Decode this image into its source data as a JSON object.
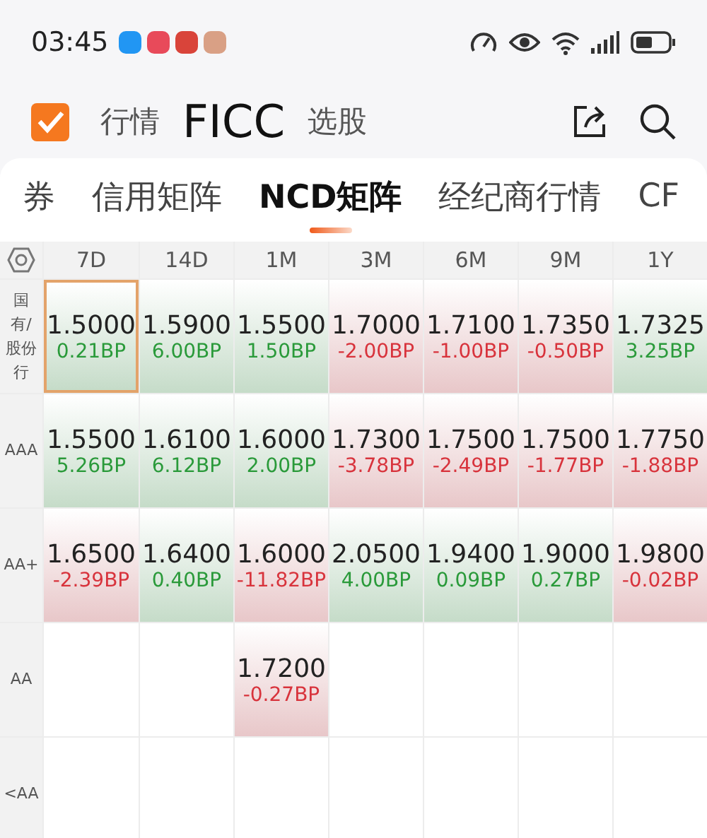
{
  "status_bar": {
    "time": "03:45"
  },
  "header": {
    "tabs": [
      {
        "label": "行情",
        "selected": false
      },
      {
        "label": "FICC",
        "selected": true
      },
      {
        "label": "选股",
        "selected": false
      }
    ]
  },
  "sub_tabs": [
    {
      "label": "券",
      "selected": false
    },
    {
      "label": "信用矩阵",
      "selected": false
    },
    {
      "label": "NCD矩阵",
      "selected": true
    },
    {
      "label": "经纪商行情",
      "selected": false
    },
    {
      "label": "CF",
      "selected": false
    }
  ],
  "table": {
    "columns": [
      "7D",
      "14D",
      "1M",
      "3M",
      "6M",
      "9M",
      "1Y"
    ],
    "rows": [
      {
        "label": [
          "国",
          "有/",
          "股份",
          "行"
        ],
        "cells": [
          {
            "kind": "quote",
            "value": "1.5000",
            "change": "0.21BP",
            "color": "#2a9a3a",
            "selected": true
          },
          {
            "kind": "quote",
            "value": "1.5900",
            "change": "6.00BP",
            "color": "#2a9a3a",
            "selected": false
          },
          {
            "kind": "quote",
            "value": "1.5500",
            "change": "1.50BP",
            "color": "#2a9a3a",
            "selected": false
          },
          {
            "kind": "quote",
            "value": "1.7000",
            "change": "-2.00BP",
            "color": "#d8333c",
            "selected": false
          },
          {
            "kind": "quote",
            "value": "1.7100",
            "change": "-1.00BP",
            "color": "#d8333c",
            "selected": false
          },
          {
            "kind": "quote",
            "value": "1.7350",
            "change": "-0.50BP",
            "color": "#d8333c",
            "selected": false
          },
          {
            "kind": "quote",
            "value": "1.7325",
            "change": "3.25BP",
            "color": "#2a9a3a",
            "selected": false
          }
        ]
      },
      {
        "label": [
          "AAA"
        ],
        "cells": [
          {
            "kind": "quote",
            "value": "1.5500",
            "change": "5.26BP",
            "color": "#2a9a3a",
            "selected": false
          },
          {
            "kind": "quote",
            "value": "1.6100",
            "change": "6.12BP",
            "color": "#2a9a3a",
            "selected": false
          },
          {
            "kind": "quote",
            "value": "1.6000",
            "change": "2.00BP",
            "color": "#2a9a3a",
            "selected": false
          },
          {
            "kind": "quote",
            "value": "1.7300",
            "change": "-3.78BP",
            "color": "#d8333c",
            "selected": false
          },
          {
            "kind": "quote",
            "value": "1.7500",
            "change": "-2.49BP",
            "color": "#d8333c",
            "selected": false
          },
          {
            "kind": "quote",
            "value": "1.7500",
            "change": "-1.77BP",
            "color": "#d8333c",
            "selected": false
          },
          {
            "kind": "quote",
            "value": "1.7750",
            "change": "-1.88BP",
            "color": "#d8333c",
            "selected": false
          }
        ]
      },
      {
        "label": [
          "AA+"
        ],
        "cells": [
          {
            "kind": "quote",
            "value": "1.6500",
            "change": "-2.39BP",
            "color": "#d8333c",
            "selected": false
          },
          {
            "kind": "quote",
            "value": "1.6400",
            "change": "0.40BP",
            "color": "#2a9a3a",
            "selected": false
          },
          {
            "kind": "quote",
            "value": "1.6000",
            "change": "-11.82BP",
            "color": "#d8333c",
            "selected": false
          },
          {
            "kind": "quote",
            "value": "2.0500",
            "change": "4.00BP",
            "color": "#2a9a3a",
            "selected": false
          },
          {
            "kind": "quote",
            "value": "1.9400",
            "change": "0.09BP",
            "color": "#2a9a3a",
            "selected": false
          },
          {
            "kind": "quote",
            "value": "1.9000",
            "change": "0.27BP",
            "color": "#2a9a3a",
            "selected": false
          },
          {
            "kind": "quote",
            "value": "1.9800",
            "change": "-0.02BP",
            "color": "#d8333c",
            "selected": false
          }
        ]
      },
      {
        "label": [
          "AA"
        ],
        "cells": [
          {
            "kind": "empty"
          },
          {
            "kind": "empty"
          },
          {
            "kind": "quote",
            "value": "1.7200",
            "change": "-0.27BP",
            "color": "#d8333c",
            "selected": false
          },
          {
            "kind": "empty"
          },
          {
            "kind": "empty"
          },
          {
            "kind": "empty"
          },
          {
            "kind": "empty"
          }
        ]
      },
      {
        "label": [
          "<AA"
        ],
        "cells": [
          {
            "kind": "empty"
          },
          {
            "kind": "empty"
          },
          {
            "kind": "empty"
          },
          {
            "kind": "empty"
          },
          {
            "kind": "empty"
          },
          {
            "kind": "empty"
          },
          {
            "kind": "empty"
          }
        ]
      }
    ]
  }
}
